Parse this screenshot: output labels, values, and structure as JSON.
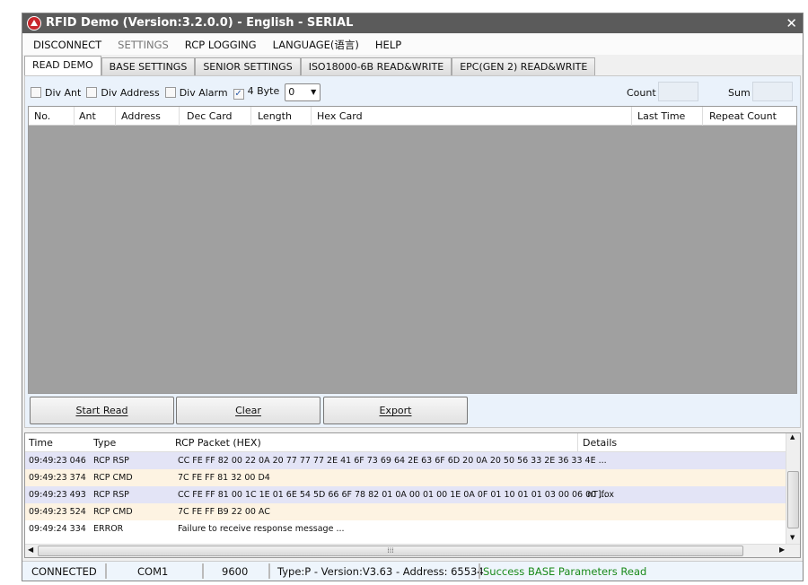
{
  "window": {
    "title": "RFID Demo (Version:3.2.0.0) - English - SERIAL",
    "close": "✕"
  },
  "menu": [
    {
      "label": "DISCONNECT"
    },
    {
      "label": "SETTINGS",
      "disabled": true
    },
    {
      "label": "RCP LOGGING"
    },
    {
      "label": "LANGUAGE(语言)"
    },
    {
      "label": "HELP"
    }
  ],
  "tabs": [
    {
      "label": "READ DEMO",
      "active": true
    },
    {
      "label": "BASE SETTINGS"
    },
    {
      "label": "SENIOR SETTINGS"
    },
    {
      "label": "ISO18000-6B READ&WRITE"
    },
    {
      "label": "EPC(GEN 2) READ&WRITE"
    }
  ],
  "options": {
    "div_ant": {
      "label": "Div Ant",
      "checked": false
    },
    "div_address": {
      "label": "Div Address",
      "checked": false
    },
    "div_alarm": {
      "label": "Div Alarm",
      "checked": false
    },
    "four_byte": {
      "label": "4 Byte",
      "checked": true
    },
    "select_value": "0",
    "count_label": "Count",
    "count_value": "",
    "sum_label": "Sum",
    "sum_value": ""
  },
  "grid": {
    "columns": [
      "No.",
      "Ant",
      "Address",
      "Dec Card",
      "Length",
      "Hex Card",
      "Last Time",
      "Repeat Count"
    ]
  },
  "buttons": {
    "start": "Start Read",
    "clear": "Clear",
    "export": "Export"
  },
  "log": {
    "columns": [
      "Time",
      "Type",
      "RCP Packet (HEX)",
      "Details"
    ],
    "rows": [
      {
        "time": "09:49:23 046",
        "type": "RCP RSP",
        "packet": "CC FE FF 82 00 22 0A 20 77 77 77 2E 41 6F 73 69 64 2E 63 6F 6D 20 0A 20 50 56 33 2E 36 33 4E ...",
        "details": ""
      },
      {
        "time": "09:49:23 374",
        "type": "RCP CMD",
        "packet": "7C FE FF 81 32 00 D4",
        "details": ""
      },
      {
        "time": "09:49:23 493",
        "type": "RCP RSP",
        "packet": "CC FE FF 81 00 1C 1E 01 6E 54 5D 66 6F 78 82 01 0A 00 01 00 1E 0A 0F 01 10 01 01 03 00 06 00 ...",
        "details": "nT]fox"
      },
      {
        "time": "09:49:23 524",
        "type": "RCP CMD",
        "packet": "7C FE FF B9 22 00 AC",
        "details": ""
      },
      {
        "time": "09:49:24 334",
        "type": "ERROR",
        "packet": "Failure to receive response message ...",
        "details": ""
      }
    ]
  },
  "status": {
    "connection": "CONNECTED",
    "port": "COM1",
    "baud": "9600",
    "device": "Type:P - Version:V3.63 - Address: 65534",
    "message": "Success BASE Parameters Read",
    "message_color": "#1a8a1a"
  }
}
